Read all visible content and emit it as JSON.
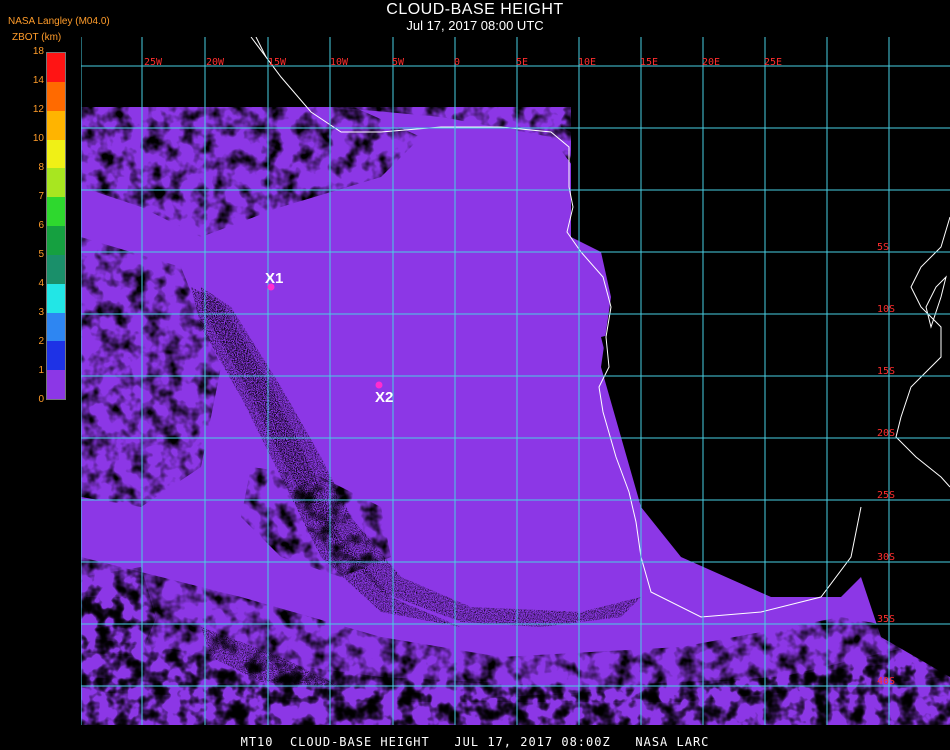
{
  "header": {
    "title": "CLOUD-BASE HEIGHT",
    "date": "Jul 17, 2017 08:00 UTC",
    "org": "NASA Langley (M04.0)",
    "units": "ZBOT (km)"
  },
  "legend": {
    "ticks": [
      "0",
      "1",
      "2",
      "3",
      "4",
      "5",
      "6",
      "7",
      "8",
      "10",
      "12",
      "14",
      "18"
    ],
    "colors": [
      "#8c37e6",
      "#1e32e6",
      "#2e86f2",
      "#22e6e6",
      "#1a8f6a",
      "#15a040",
      "#2ed82e",
      "#a8e620",
      "#f0f016",
      "#ffb400",
      "#ff6a00",
      "#ff1414",
      "#b00000",
      "#501010"
    ]
  },
  "map": {
    "colors": {
      "background": "#000000",
      "low_cloud": "#8c37e6",
      "grid": "#49cfe3",
      "coast": "#ffffff",
      "marker": "#ff2ccf",
      "band_orange": "#ff7a1c",
      "band_cyan": "#22d8e6",
      "band_green": "#2ed82e",
      "band_yellow": "#f0f016",
      "band_blue": "#1e32e6",
      "band_red": "#ff2020"
    },
    "lat_labels": [
      "5S",
      "10S",
      "15S",
      "20S",
      "25S",
      "30S",
      "35S",
      "40S"
    ],
    "lon_labels": [
      "25W",
      "20W",
      "15W",
      "10W",
      "5W",
      "0",
      "5E",
      "10E",
      "15E",
      "20E",
      "25E"
    ],
    "markers": [
      {
        "label": "X1"
      },
      {
        "label": "X2"
      }
    ]
  },
  "footer": {
    "text": "MT10  CLOUD-BASE HEIGHT   JUL 17, 2017 08:00Z   NASA LARC"
  }
}
